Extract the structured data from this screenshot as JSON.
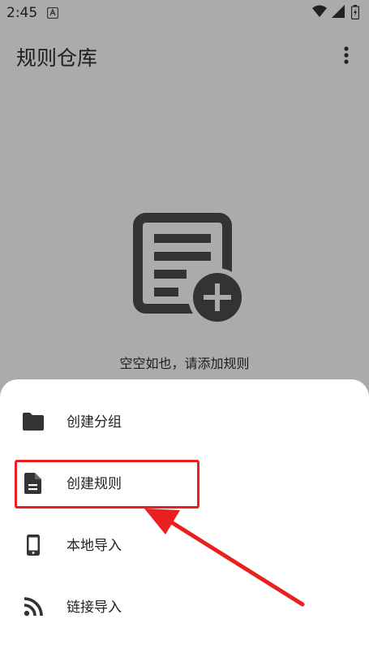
{
  "status_bar": {
    "time": "2:45"
  },
  "app_bar": {
    "title": "规则仓库"
  },
  "empty_state": {
    "message": "空空如也，请添加规则"
  },
  "sheet": {
    "items": [
      {
        "label": "创建分组",
        "icon": "folder-icon"
      },
      {
        "label": "创建规则",
        "icon": "document-icon"
      },
      {
        "label": "本地导入",
        "icon": "phone-icon"
      },
      {
        "label": "链接导入",
        "icon": "rss-icon"
      }
    ]
  },
  "annotation": {
    "highlight_color": "#e8201f"
  }
}
